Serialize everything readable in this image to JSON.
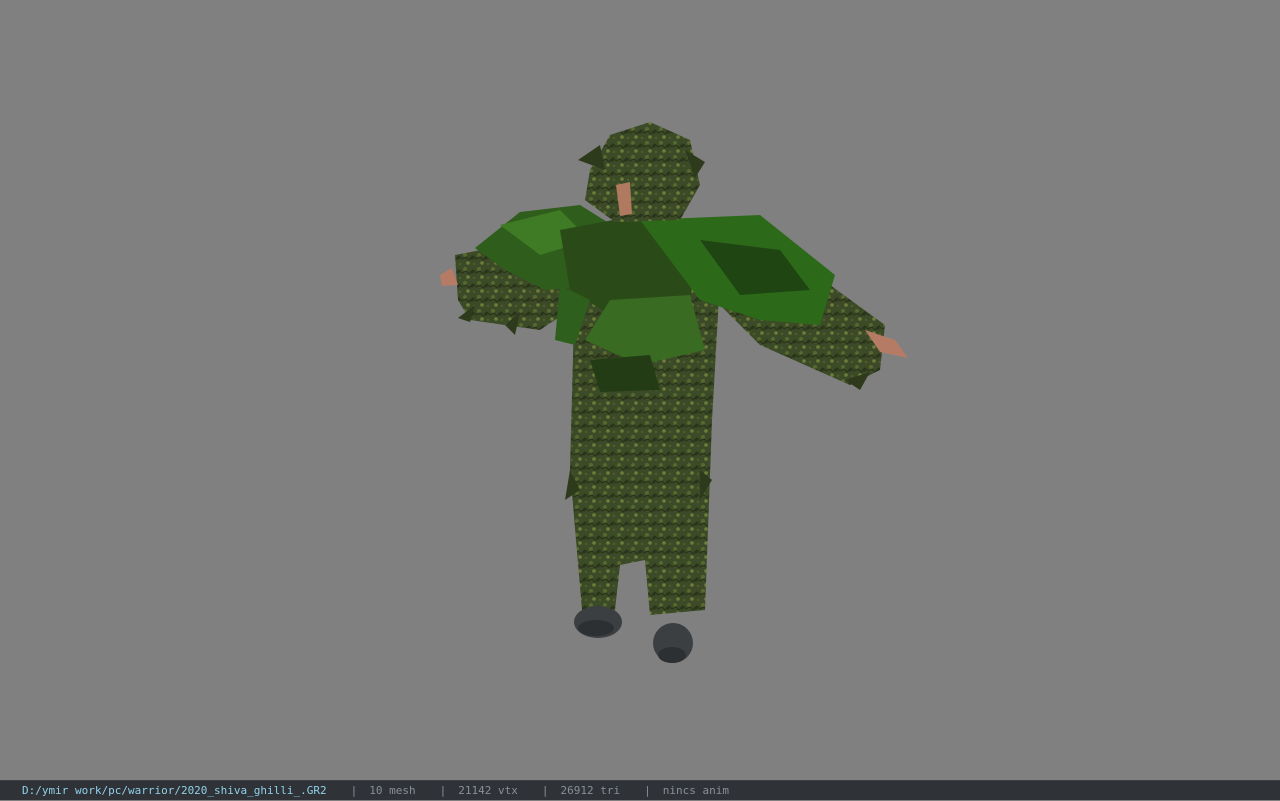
{
  "viewer": {
    "background_color": "#808080",
    "model": "ghillie-suit-character"
  },
  "status_bar": {
    "file_path": "D:/ymir work/pc/warrior/2020_shiva_ghilli_.GR2",
    "separator": "|",
    "mesh_count": "10 mesh",
    "vertex_count": "21142 vtx",
    "triangle_count": "26912 tri",
    "animation": "nincs anim"
  }
}
